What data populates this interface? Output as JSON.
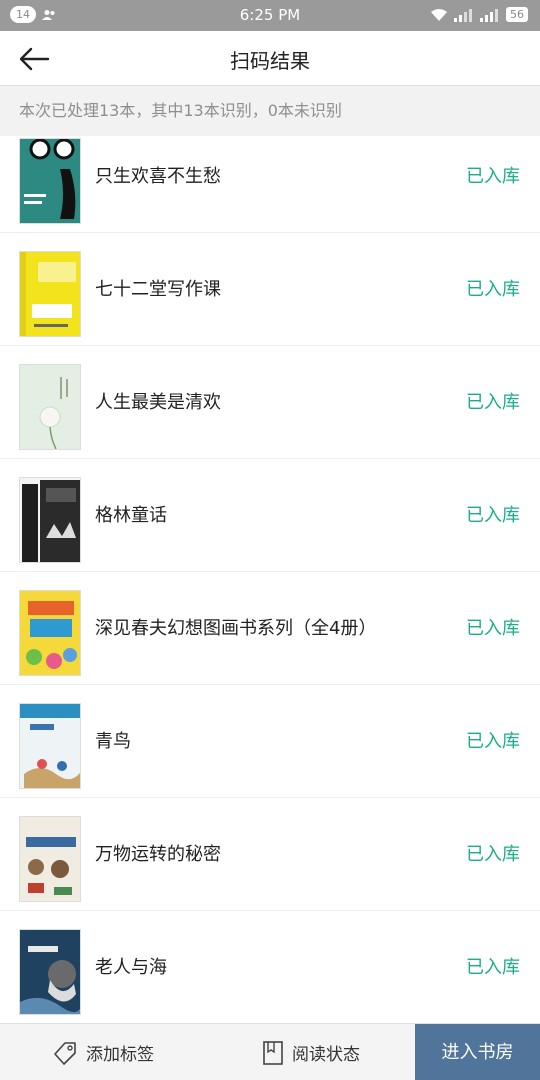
{
  "statusbar": {
    "notif_count": "14",
    "time": "6:25 PM",
    "battery": "56"
  },
  "header": {
    "title": "扫码结果"
  },
  "summary": {
    "text": "本次已处理13本，其中13本识别，0本未识别"
  },
  "books": [
    {
      "title": "只生欢喜不生愁",
      "status": "已入库",
      "cover_color": "#2d8a82"
    },
    {
      "title": "七十二堂写作课",
      "status": "已入库",
      "cover_color": "#f3e31c"
    },
    {
      "title": "人生最美是清欢",
      "status": "已入库",
      "cover_color": "#e4efe4"
    },
    {
      "title": "格林童话",
      "status": "已入库",
      "cover_color": "#2b2b2b"
    },
    {
      "title": "深见春夫幻想图画书系列（全4册）",
      "status": "已入库",
      "cover_color": "#f5d83a"
    },
    {
      "title": "青鸟",
      "status": "已入库",
      "cover_color": "#eef3f6"
    },
    {
      "title": "万物运转的秘密",
      "status": "已入库",
      "cover_color": "#f1ece2"
    },
    {
      "title": "老人与海",
      "status": "已入库",
      "cover_color": "#1f4260"
    }
  ],
  "bottombar": {
    "tag_label": "添加标签",
    "read_label": "阅读状态",
    "enter_label": "进入书房"
  },
  "colors": {
    "accent_green": "#1aad8a",
    "enter_button": "#51759a"
  }
}
